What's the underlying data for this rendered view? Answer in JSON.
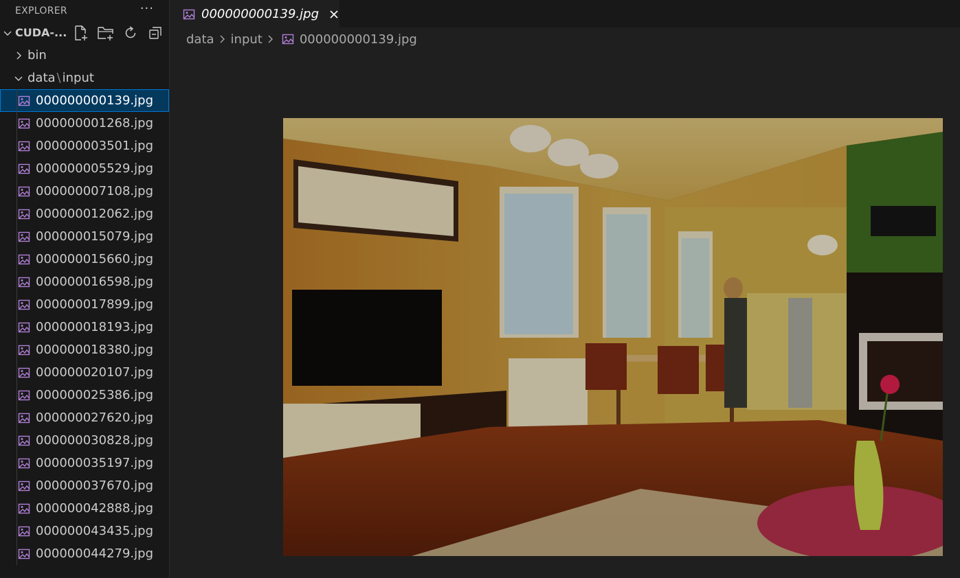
{
  "sidebar": {
    "title": "EXPLORER",
    "more_label": "···",
    "root_folder": "CUDA-...",
    "folders": [
      {
        "label": "bin",
        "expanded": false
      },
      {
        "label_a": "data",
        "label_sep": "\\",
        "label_b": "input",
        "expanded": true
      }
    ],
    "files": [
      "000000000139.jpg",
      "000000001268.jpg",
      "000000003501.jpg",
      "000000005529.jpg",
      "000000007108.jpg",
      "000000012062.jpg",
      "000000015079.jpg",
      "000000015660.jpg",
      "000000016598.jpg",
      "000000017899.jpg",
      "000000018193.jpg",
      "000000018380.jpg",
      "000000020107.jpg",
      "000000025386.jpg",
      "000000027620.jpg",
      "000000030828.jpg",
      "000000035197.jpg",
      "000000037670.jpg",
      "000000042888.jpg",
      "000000043435.jpg",
      "000000044279.jpg"
    ],
    "selected_index": 0
  },
  "tab": {
    "label": "000000000139.jpg",
    "icons": {
      "file": "image-file-icon",
      "close": "close-icon"
    }
  },
  "breadcrumb": {
    "parts": [
      "data",
      "input"
    ],
    "file": "000000000139.jpg"
  },
  "colors": {
    "accent": "#0078d4",
    "selection": "#04395e",
    "image_icon": "#b180d7"
  }
}
